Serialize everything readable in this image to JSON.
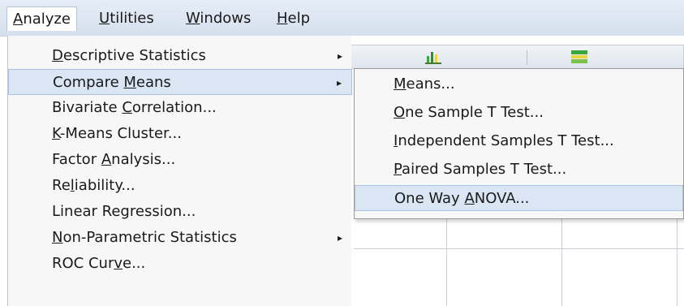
{
  "menubar": {
    "items": [
      {
        "key": "A",
        "rest": "nalyze"
      },
      {
        "key": "U",
        "rest": "tilities"
      },
      {
        "key": "W",
        "rest": "indows"
      },
      {
        "key": "H",
        "rest": "elp"
      }
    ]
  },
  "analyze_menu": {
    "items": [
      {
        "pre": "",
        "key": "D",
        "post": "escriptive Statistics",
        "submenu_arrow": "▸"
      },
      {
        "pre": "Compare ",
        "key": "M",
        "post": "eans",
        "submenu_arrow": "▸"
      },
      {
        "pre": "Bivariate ",
        "key": "C",
        "post": "orrelation..."
      },
      {
        "pre": "",
        "key": "K",
        "post": "-Means Cluster..."
      },
      {
        "pre": "Factor ",
        "key": "A",
        "post": "nalysis..."
      },
      {
        "pre": "Re",
        "key": "l",
        "post": "iability..."
      },
      {
        "pre": "Linear Regression...",
        "key": "",
        "post": ""
      },
      {
        "pre": "",
        "key": "N",
        "post": "on-Parametric Statistics",
        "submenu_arrow": "▸"
      },
      {
        "pre": "ROC Cur",
        "key": "v",
        "post": "e..."
      }
    ]
  },
  "compare_means_submenu": {
    "items": [
      {
        "pre": "",
        "key": "M",
        "post": "eans..."
      },
      {
        "pre": "",
        "key": "O",
        "post": "ne Sample T Test..."
      },
      {
        "pre": "",
        "key": "I",
        "post": "ndependent Samples T Test..."
      },
      {
        "pre": "",
        "key": "P",
        "post": "aired Samples T Test..."
      },
      {
        "pre": "One Way ",
        "key": "A",
        "post": "NOVA..."
      }
    ]
  },
  "colors": {
    "highlight": "#dae6f4",
    "menubar": "#dbe4f0",
    "icon_green": "#3aa83a",
    "icon_yellow": "#e8d640"
  },
  "icons": [
    "chart-icon",
    "table-icon"
  ]
}
